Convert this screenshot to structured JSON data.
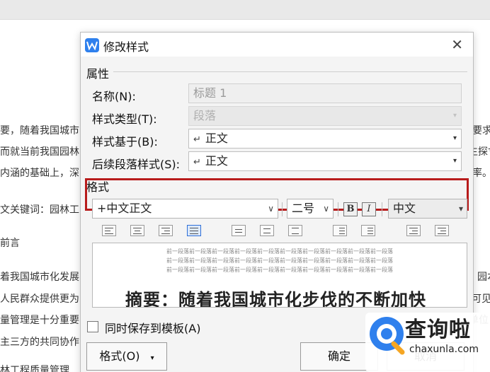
{
  "background_doc": {
    "lines": [
      {
        "left": "要，随着我国城市",
        "right": "要求"
      },
      {
        "left": "而就当前我国园林",
        "right": "生探寸"
      },
      {
        "left": "内涵的基础上，深",
        "right": "率。"
      },
      {
        "left": "文关键词：园林工",
        "right": ""
      },
      {
        "left": "前言",
        "right": ""
      },
      {
        "left": "着我国城市化发展",
        "right": "园本"
      },
      {
        "left": "人民群众提供更为",
        "right": "可见,"
      },
      {
        "left": "量管理是十分重要",
        "right": "单位"
      },
      {
        "left": "主三方的共同协作",
        "right": ""
      },
      {
        "left": "林工程质量管理",
        "right": ""
      }
    ]
  },
  "dialog": {
    "title": "修改样式",
    "close_glyph": "✕",
    "section_properties": "属性",
    "name_label": "名称(N):",
    "name_value": "标题 1",
    "style_type_label": "样式类型(T):",
    "style_type_value": "段落",
    "based_on_label": "样式基于(B):",
    "based_on_value": "正文",
    "next_style_label": "后续段落样式(S):",
    "next_style_value": "正文",
    "section_format": "格式",
    "font_value": "+中文正文",
    "size_value": "二号",
    "bold_label": "B",
    "italic_label": "I",
    "lang_value": "中文",
    "preview_prev_para": "前一段落前一段落前一段落前一段落前一段落前一段落前一段落前一段落前一段落前一段落",
    "preview_sample": "摘要：随着我国城市化步伐的不断加快",
    "save_to_template_label": "同时保存到模板(A)",
    "format_button": "格式(O)",
    "ok_button": "确定",
    "cancel_button": "取消"
  },
  "watermark": {
    "brand": "查询啦",
    "url": "chaxunla.com"
  },
  "colors": {
    "highlight_border": "#b81c1c",
    "app_icon": "#2f80ed",
    "watermark_blue": "#2f80ed"
  }
}
